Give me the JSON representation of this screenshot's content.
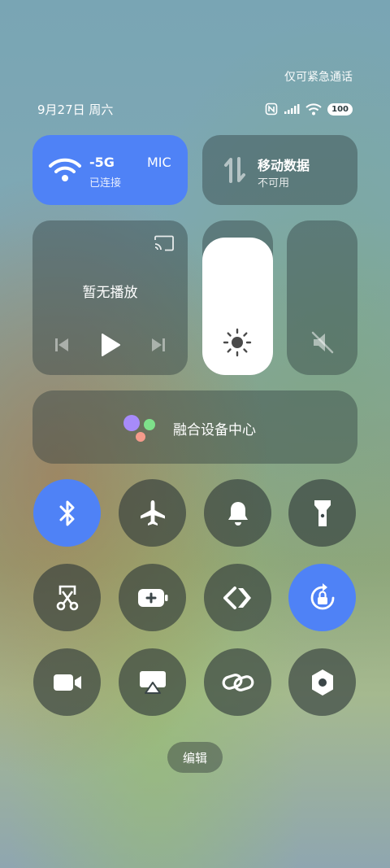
{
  "status": {
    "emergency": "仅可紧急通话",
    "date": "9月27日 周六",
    "battery": "100"
  },
  "tiles": {
    "wifi": {
      "name": "-5G",
      "name2": "MIC",
      "state": "已连接",
      "active": true
    },
    "mobile_data": {
      "title": "移动数据",
      "state": "不可用"
    },
    "media": {
      "title": "暂无播放"
    },
    "brightness": {
      "level": 0.89
    },
    "volume": {
      "muted": true
    },
    "device_hub": {
      "title": "融合设备中心"
    }
  },
  "toggles": [
    {
      "icon": "bluetooth-icon",
      "active": true
    },
    {
      "icon": "airplane-icon",
      "active": false
    },
    {
      "icon": "bell-icon",
      "active": false
    },
    {
      "icon": "flashlight-icon",
      "active": false
    },
    {
      "icon": "screenshot-scissors-icon",
      "active": false
    },
    {
      "icon": "battery-saver-icon",
      "active": false
    },
    {
      "icon": "nearby-share-icon",
      "active": false
    },
    {
      "icon": "rotation-lock-icon",
      "active": true
    },
    {
      "icon": "video-camera-icon",
      "active": false
    },
    {
      "icon": "screen-cast-icon",
      "active": false
    },
    {
      "icon": "link-icon",
      "active": false
    },
    {
      "icon": "settings-hex-icon",
      "active": false
    }
  ],
  "edit_label": "编辑",
  "colors": {
    "accent": "#4f82f6"
  }
}
